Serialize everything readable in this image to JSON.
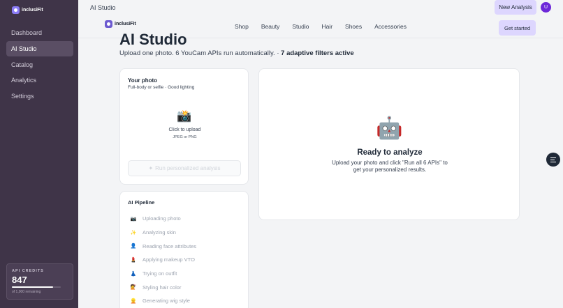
{
  "app": {
    "name": "inclusiFit"
  },
  "sidebar": {
    "items": [
      {
        "label": "Dashboard"
      },
      {
        "label": "AI Studio"
      },
      {
        "label": "Catalog"
      },
      {
        "label": "Analytics"
      },
      {
        "label": "Settings"
      }
    ],
    "active_index": 1,
    "credits": {
      "label": "API CREDITS",
      "value": "847",
      "remaining": "of 1,000 remaining",
      "fraction": 0.847
    }
  },
  "topbar": {
    "title": "AI Studio",
    "new_button": "New Analysis",
    "avatar_initial": "U"
  },
  "navbar": {
    "brand": "inclusiFit",
    "links": [
      "Shop",
      "Beauty",
      "Studio",
      "Hair",
      "Shoes",
      "Accessories"
    ],
    "cta": "Get started"
  },
  "hero": {
    "title": "AI Studio",
    "subtitle_main": "Upload one photo. 6 YouCam APIs run automatically. · ",
    "subtitle_bold": "7 adaptive filters active"
  },
  "upload": {
    "title": "Your photo",
    "subtitle": "Full-body or selfie · Good lighting",
    "camera_icon": "📸",
    "click_text": "Click to upload",
    "formats": "JPEG or PNG",
    "run_button": "Run personalized analysis",
    "run_icon": "✦"
  },
  "result": {
    "robot_icon": "🤖",
    "title": "Ready to analyze",
    "body": "Upload your photo and click \"Run all 6 APIs\" to get your personalized results."
  },
  "pipeline": {
    "title": "AI Pipeline",
    "steps": [
      {
        "icon": "📷",
        "label": "Uploading photo"
      },
      {
        "icon": "✨",
        "label": "Analyzing skin"
      },
      {
        "icon": "👤",
        "label": "Reading face attributes"
      },
      {
        "icon": "💄",
        "label": "Applying makeup VTO"
      },
      {
        "icon": "👗",
        "label": "Trying on outfit"
      },
      {
        "icon": "💇",
        "label": "Styling hair color"
      },
      {
        "icon": "👱",
        "label": "Generating wig style"
      }
    ]
  },
  "colors": {
    "sidebar_bg": "#3f3448",
    "accent": "#ddd6fe",
    "avatar": "#6d28d9"
  },
  "icons": {
    "brand": "logo-icon",
    "fab": "settings-sliders-icon"
  }
}
